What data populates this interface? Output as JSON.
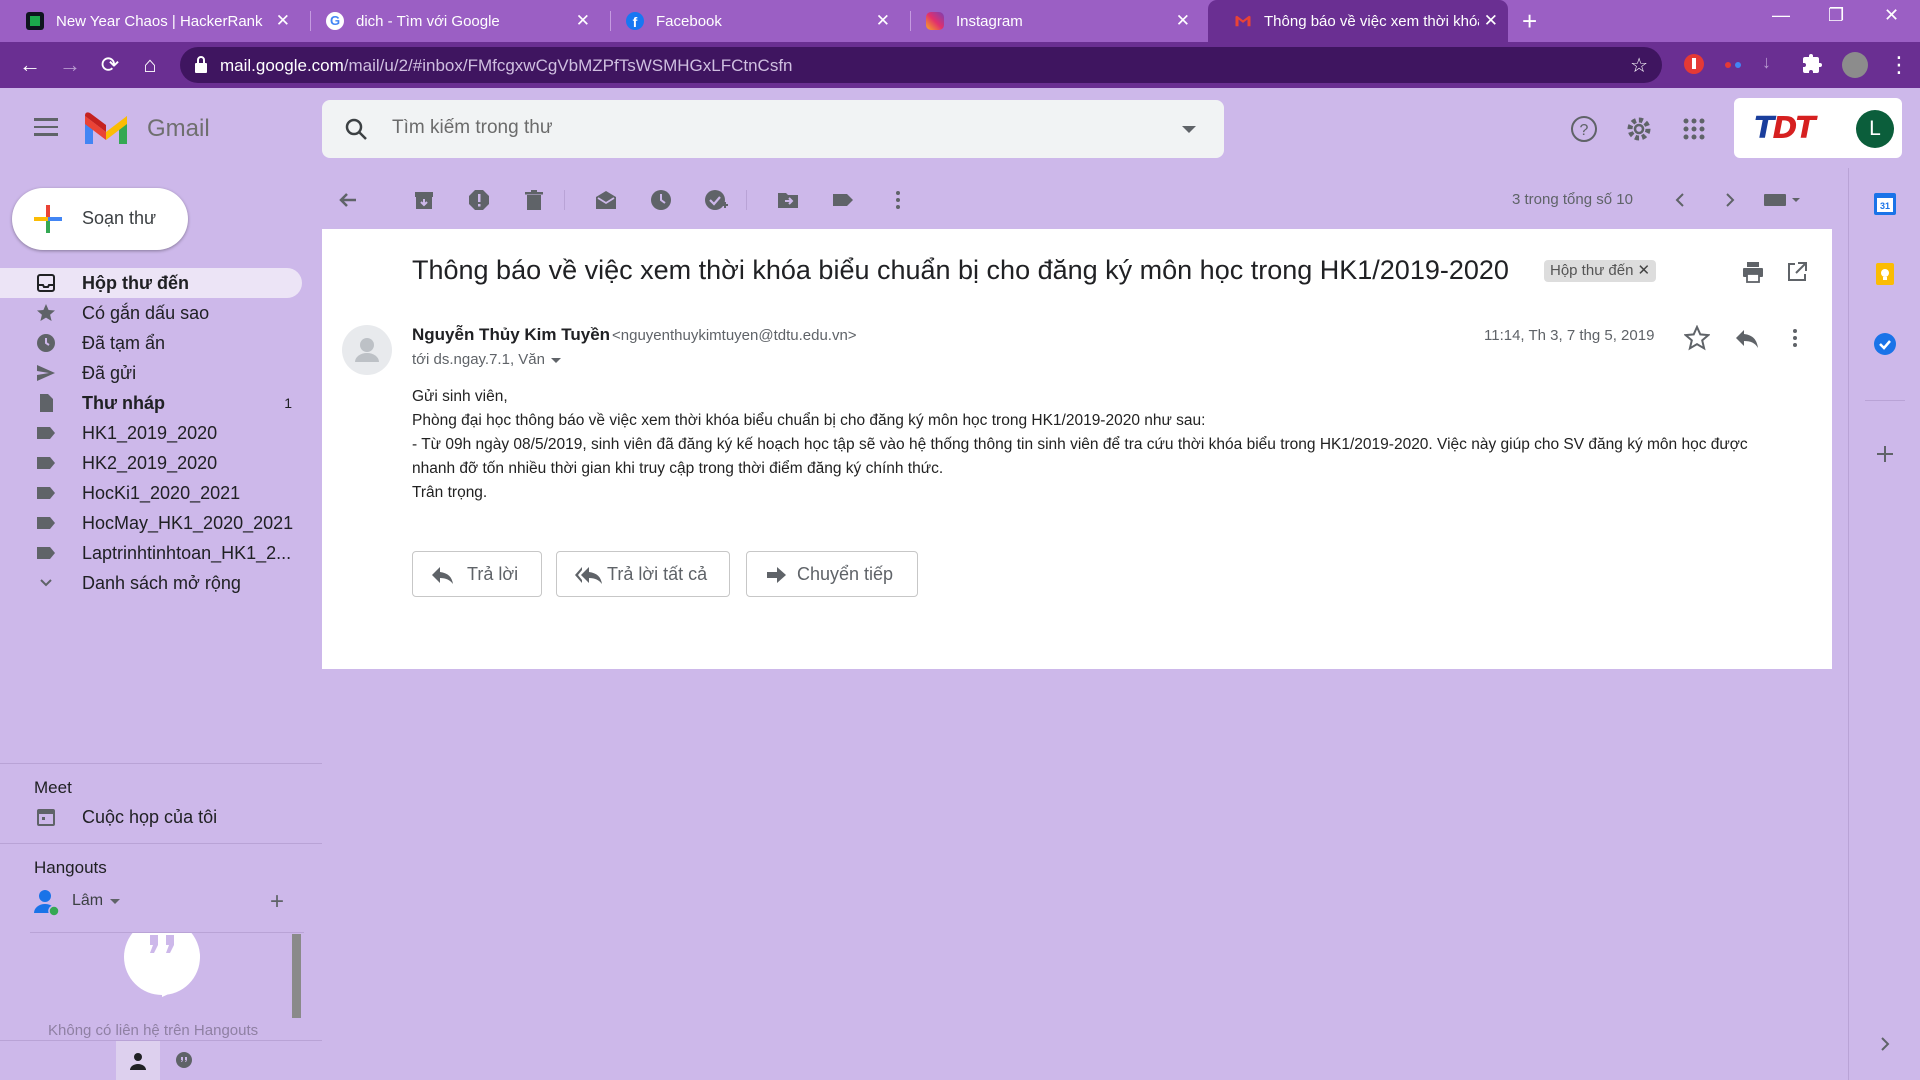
{
  "browser": {
    "tabs": [
      {
        "title": "New Year Chaos | HackerRank",
        "favicon": "hackerrank-icon",
        "color": "#1ba94c"
      },
      {
        "title": "dich - Tìm với Google",
        "favicon": "google-icon",
        "color": "#4285f4"
      },
      {
        "title": "Facebook",
        "favicon": "facebook-icon",
        "color": "#1877f2"
      },
      {
        "title": "Instagram",
        "favicon": "instagram-icon",
        "color": "#e1306c"
      },
      {
        "title": "Thông báo về việc xem thời khóa biểu",
        "favicon": "gmail-icon",
        "color": "#ea4335"
      }
    ],
    "url_domain": "mail.google.com",
    "url_path": "/mail/u/2/#inbox/FMfcgxwCgVbMZPfTsWSMHGxLFCtnCsfn"
  },
  "gmail": {
    "brand": "Gmail",
    "search_placeholder": "Tìm kiếm trong thư",
    "account_initial": "L",
    "account_logo_text_a": "T",
    "account_logo_text_b": "DT"
  },
  "sidebar": {
    "compose_label": "Soạn thư",
    "items": [
      {
        "label": "Hộp thư đến",
        "icon": "inbox-icon",
        "bold": true,
        "count": ""
      },
      {
        "label": "Có gắn dấu sao",
        "icon": "star-icon",
        "bold": false,
        "count": ""
      },
      {
        "label": "Đã tạm ẩn",
        "icon": "clock-icon",
        "bold": false,
        "count": ""
      },
      {
        "label": "Đã gửi",
        "icon": "send-icon",
        "bold": false,
        "count": ""
      },
      {
        "label": "Thư nháp",
        "icon": "draft-icon",
        "bold": true,
        "count": "1"
      },
      {
        "label": "HK1_2019_2020",
        "icon": "label-icon",
        "bold": false,
        "count": ""
      },
      {
        "label": "HK2_2019_2020",
        "icon": "label-icon",
        "bold": false,
        "count": ""
      },
      {
        "label": "HocKi1_2020_2021",
        "icon": "label-icon",
        "bold": false,
        "count": ""
      },
      {
        "label": "HocMay_HK1_2020_2021",
        "icon": "label-icon",
        "bold": false,
        "count": ""
      },
      {
        "label": "Laptrinhtinhtoan_HK1_2...",
        "icon": "label-icon",
        "bold": false,
        "count": ""
      },
      {
        "label": "Danh sách mở rộng",
        "icon": "chevron-down-icon",
        "bold": false,
        "count": ""
      }
    ],
    "meet_title": "Meet",
    "meet_item": "Cuộc họp của tôi",
    "hangouts_title": "Hangouts",
    "hangouts_user": "Lâm",
    "hangouts_empty": "Không có liên hệ trên Hangouts"
  },
  "toolbar": {
    "pager_text": "3 trong tổng số 10"
  },
  "message": {
    "subject": "Thông báo về việc xem thời khóa biểu chuẩn bị cho đăng ký môn học trong HK1/2019-2020",
    "label_chip": "Hộp thư đến",
    "sender_name": "Nguyễn Thủy Kim Tuyền",
    "sender_email": "<nguyenthuykimtuyen@tdtu.edu.vn>",
    "to_line": "tới ds.ngay.7.1, Văn",
    "date": "11:14, Th 3, 7 thg 5, 2019",
    "body": [
      "Gửi sinh viên,",
      "Phòng đại học thông báo về việc xem thời khóa biểu chuẩn bị cho đăng ký môn học trong HK1/2019-2020 như sau:",
      "- Từ 09h ngày 08/5/2019, sinh viên đã đăng ký kế hoạch học tập sẽ vào hệ thống thông tin sinh viên để tra cứu thời khóa biểu trong HK1/2019-2020. Việc này giúp cho SV đăng ký môn học được nhanh đỡ tốn nhiều thời gian khi truy cập trong thời điểm đăng ký chính thức.",
      "Trân trọng."
    ],
    "reply_label": "Trả lời",
    "reply_all_label": "Trả lời tất cả",
    "forward_label": "Chuyển tiếp"
  }
}
